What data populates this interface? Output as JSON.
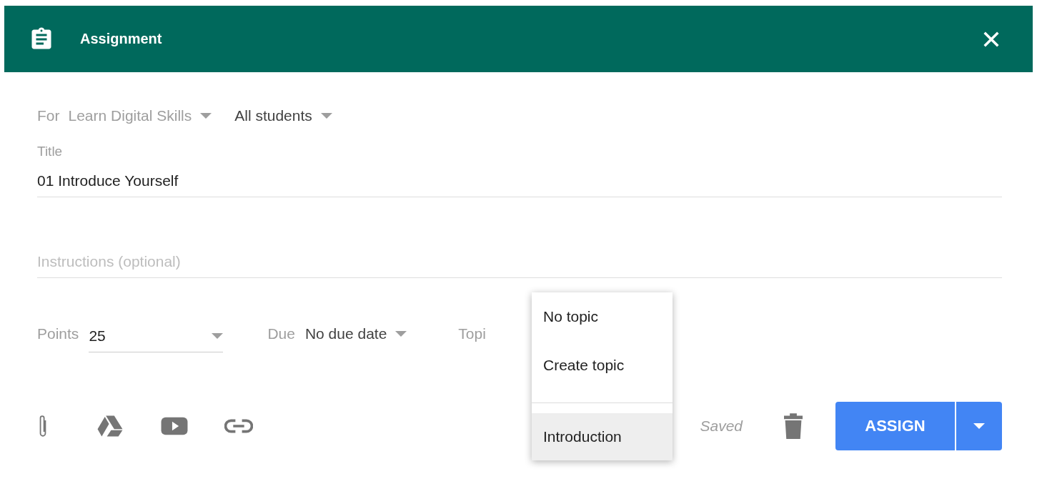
{
  "header": {
    "title": "Assignment"
  },
  "for_row": {
    "label": "For",
    "class_name": "Learn Digital Skills",
    "students": "All students"
  },
  "title_field": {
    "label": "Title",
    "value": "01 Introduce Yourself"
  },
  "instructions_field": {
    "placeholder": "Instructions (optional)"
  },
  "points": {
    "label": "Points",
    "value": "25"
  },
  "due": {
    "label": "Due",
    "value": "No due date"
  },
  "topic": {
    "label": "Topi"
  },
  "topic_menu": [
    {
      "label": "No topic",
      "selected": false
    },
    {
      "label": "Create topic",
      "selected": false
    },
    {
      "kind": "divider"
    },
    {
      "label": "Introduction",
      "selected": true
    }
  ],
  "attachments": [
    {
      "kind": "clip"
    },
    {
      "kind": "drive"
    },
    {
      "kind": "video"
    },
    {
      "kind": "link"
    }
  ],
  "status": "Saved",
  "assign_button": "ASSIGN"
}
